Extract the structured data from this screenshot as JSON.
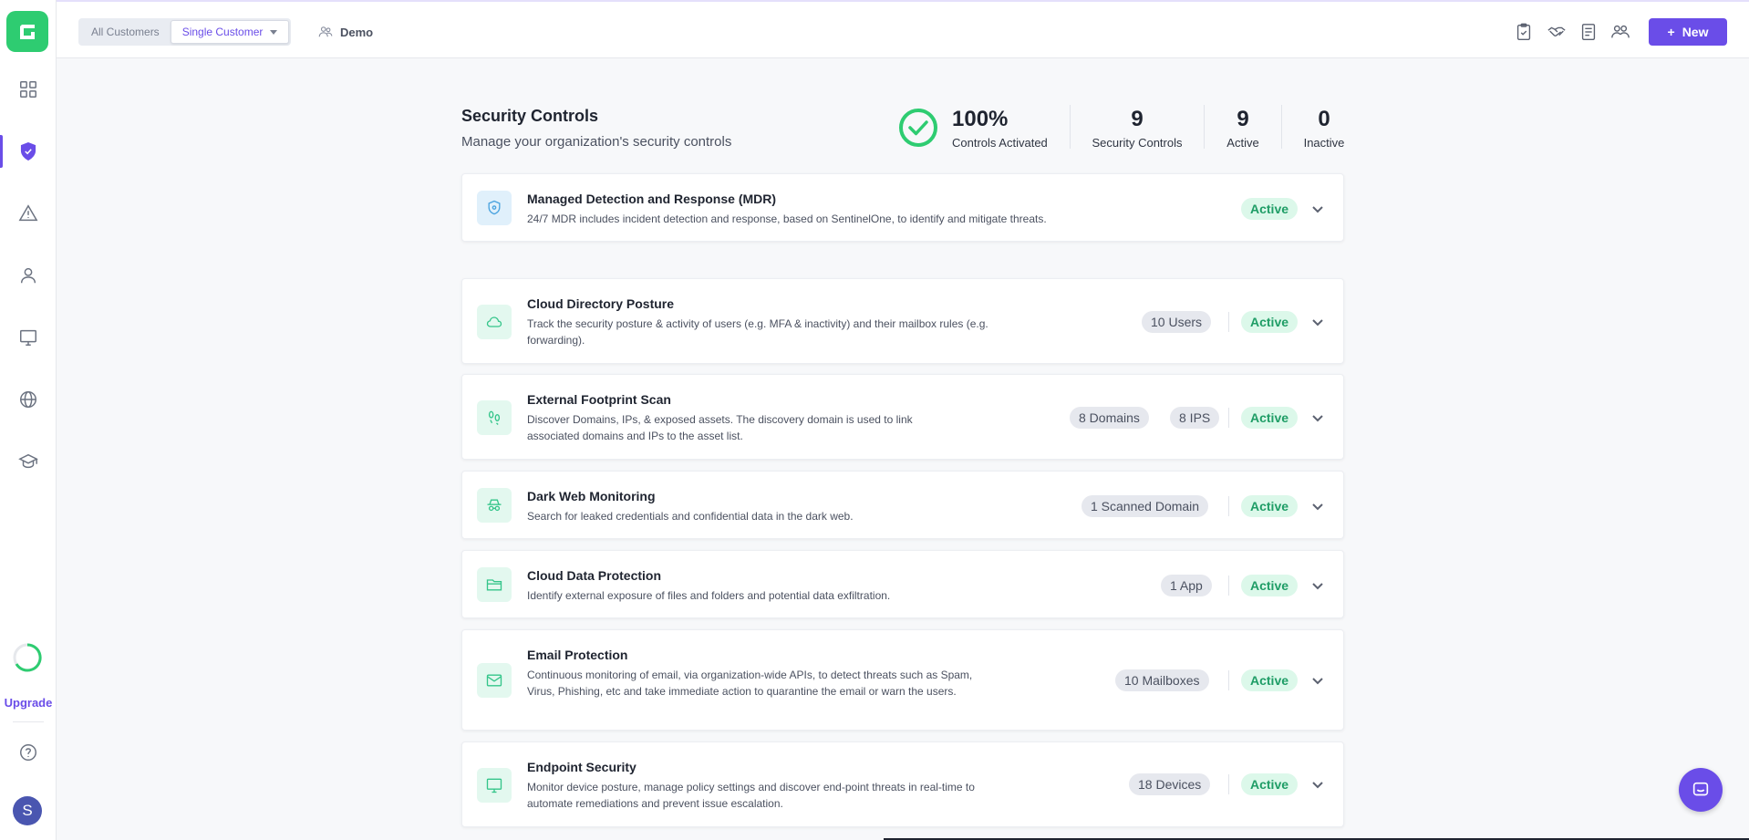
{
  "topbar": {
    "scope_options": [
      "All Customers",
      "Single Customer"
    ],
    "customer_name": "Demo",
    "new_button": "New",
    "icons": [
      "clipboard-check-icon",
      "handshake-icon",
      "document-icon",
      "team-icon"
    ]
  },
  "sidebar": {
    "items": [
      "dashboard-icon",
      "shield-icon",
      "alert-icon",
      "user-icon",
      "monitor-icon",
      "globe-icon",
      "graduation-cap-icon"
    ],
    "active": "shield-icon",
    "upgrade_label": "Upgrade",
    "avatar_initial": "S"
  },
  "header": {
    "title": "Security Controls",
    "subtitle": "Manage your organization's security controls"
  },
  "stats": {
    "activated_pct": "100%",
    "activated_label": "Controls Activated",
    "total": "9",
    "total_label": "Security Controls",
    "active": "9",
    "active_label": "Active",
    "inactive": "0",
    "inactive_label": "Inactive"
  },
  "controls": [
    {
      "title": "Managed Detection and Response (MDR)",
      "desc": "24/7 MDR includes incident detection and response, based on SentinelOne, to identify and mitigate threats.",
      "counts": [],
      "status": "Active",
      "icon": "shield-icon"
    },
    {
      "title": "Cloud Directory Posture",
      "desc": "Track the security posture & activity of users (e.g. MFA & inactivity) and their mailbox rules (e.g. forwarding).",
      "counts": [
        "10 Users"
      ],
      "status": "Active",
      "icon": "cloud-icon"
    },
    {
      "title": "External Footprint Scan",
      "desc": "Discover Domains, IPs, & exposed assets. The discovery domain is used to link associated domains and IPs to the asset list.",
      "counts": [
        "8 Domains",
        "8 IPS"
      ],
      "status": "Active",
      "icon": "footprint-icon"
    },
    {
      "title": "Dark Web Monitoring",
      "desc": "Search for leaked credentials and confidential data in the dark web.",
      "counts": [
        "1 Scanned Domain"
      ],
      "status": "Active",
      "icon": "incognito-icon"
    },
    {
      "title": "Cloud Data Protection",
      "desc": "Identify external exposure of files and folders and potential data exfiltration.",
      "counts": [
        "1 App"
      ],
      "status": "Active",
      "icon": "folder-icon"
    },
    {
      "title": "Email Protection",
      "desc": "Continuous monitoring of email, via organization-wide APIs, to detect threats such as Spam, Virus, Phishing, etc and take immediate action to quarantine the email or warn the users.",
      "counts": [
        "10 Mailboxes"
      ],
      "status": "Active",
      "icon": "mail-icon"
    },
    {
      "title": "Endpoint Security",
      "desc": "Monitor device posture, manage policy settings and discover end-point threats in real-time to automate remediations and prevent issue escalation.",
      "counts": [
        "18 Devices"
      ],
      "status": "Active",
      "icon": "monitor-icon"
    }
  ],
  "colors": {
    "accent": "#6a4de8",
    "success": "#2ecc71",
    "active_badge_bg": "#dcf8ea",
    "active_badge_text": "#1f9d66"
  }
}
